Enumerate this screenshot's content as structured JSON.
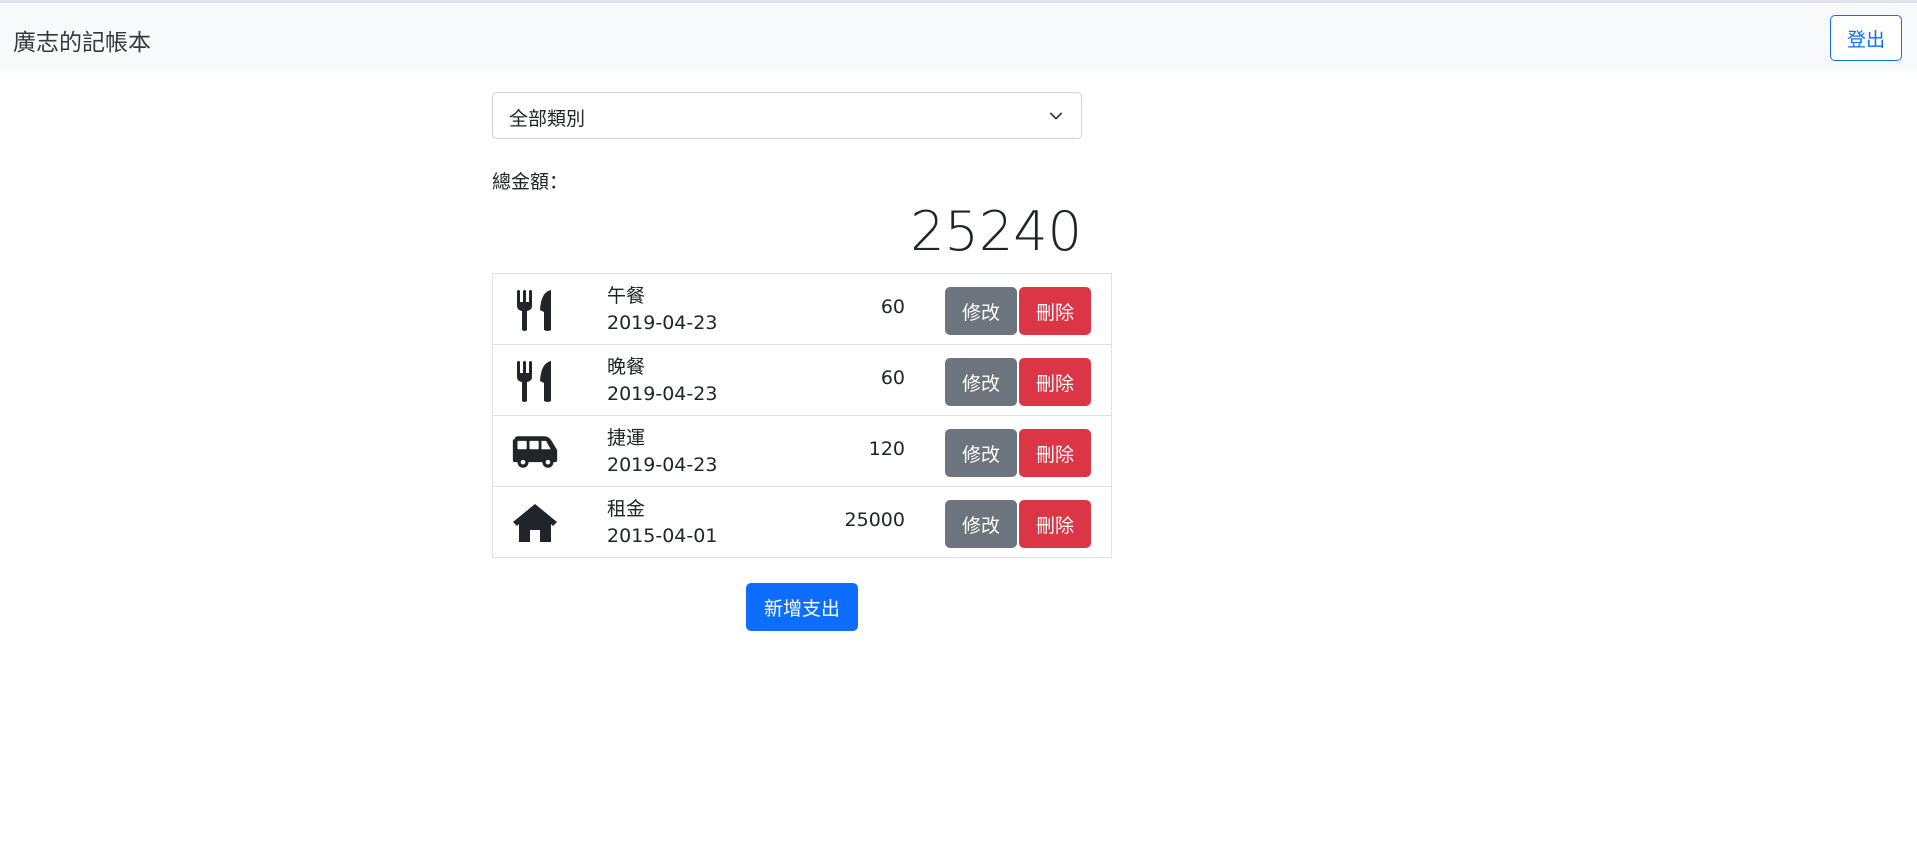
{
  "navbar": {
    "brand": "廣志的記帳本",
    "logout_label": "登出"
  },
  "filter": {
    "selected": "全部類別"
  },
  "summary": {
    "label": "總金額：",
    "total": "25240"
  },
  "expenses": [
    {
      "icon": "utensils-icon",
      "name": "午餐",
      "date": "2019-04-23",
      "amount": "60",
      "edit_label": "修改",
      "delete_label": "刪除"
    },
    {
      "icon": "utensils-icon",
      "name": "晚餐",
      "date": "2019-04-23",
      "amount": "60",
      "edit_label": "修改",
      "delete_label": "刪除"
    },
    {
      "icon": "shuttle-van-icon",
      "name": "捷運",
      "date": "2019-04-23",
      "amount": "120",
      "edit_label": "修改",
      "delete_label": "刪除"
    },
    {
      "icon": "home-icon",
      "name": "租金",
      "date": "2015-04-01",
      "amount": "25000",
      "edit_label": "修改",
      "delete_label": "刪除"
    }
  ],
  "add_button_label": "新增支出",
  "colors": {
    "primary": "#0d6efd",
    "secondary": "#6c757d",
    "danger": "#dc3545",
    "navbar_bg": "#f8f9fa"
  }
}
